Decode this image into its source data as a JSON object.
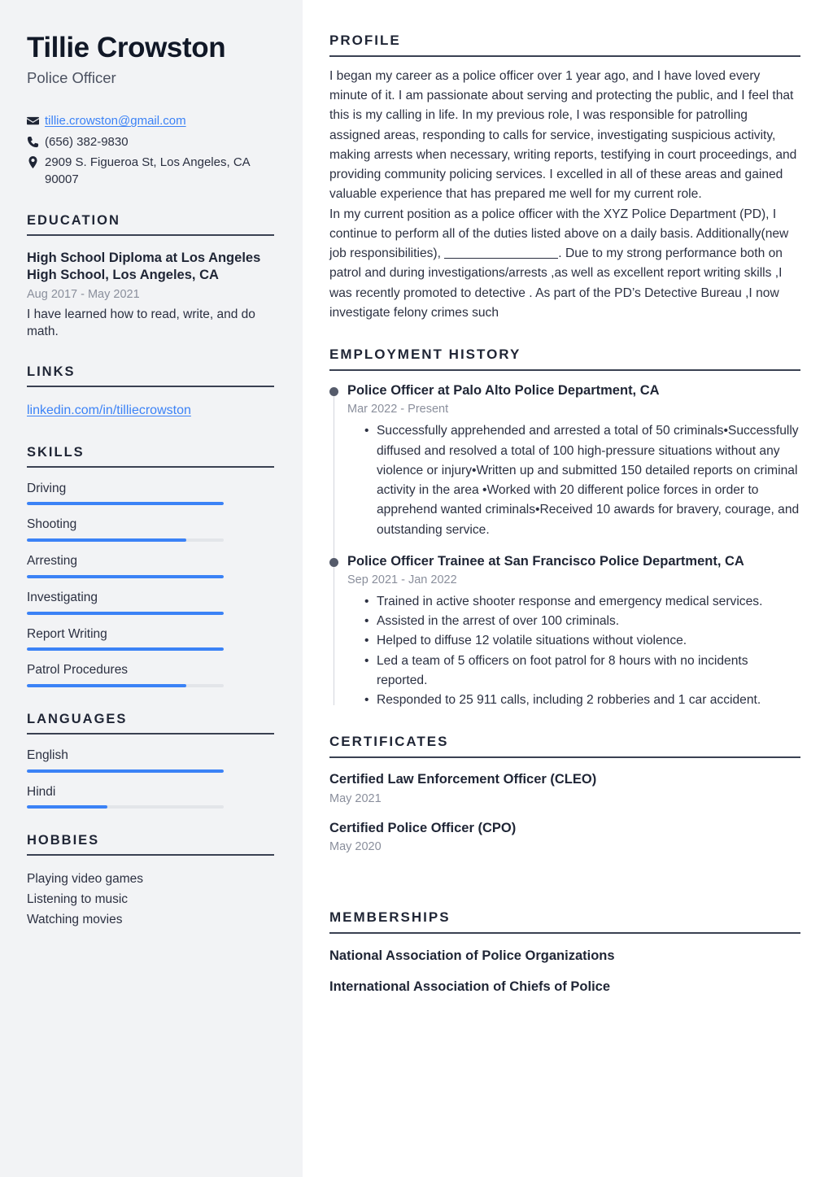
{
  "header": {
    "name": "Tillie Crowston",
    "job_title": "Police Officer"
  },
  "contact": {
    "email": "tillie.crowston@gmail.com",
    "email_icon": "envelope-icon",
    "phone": "(656) 382-9830",
    "phone_icon": "phone-icon",
    "address": "2909 S. Figueroa St, Los Angeles, CA 90007",
    "address_icon": "location-pin-icon"
  },
  "education": {
    "heading": "EDUCATION",
    "degree": "High School Diploma at Los Angeles High School, Los Angeles, CA",
    "date": "Aug 2017 - May 2021",
    "description": "I have learned how to read, write, and do math."
  },
  "links": {
    "heading": "LINKS",
    "items": [
      {
        "label": "linkedin.com/in/tilliecrowston"
      }
    ]
  },
  "skills": {
    "heading": "SKILLS",
    "items": [
      {
        "label": "Driving",
        "level": 100
      },
      {
        "label": "Shooting",
        "level": 81
      },
      {
        "label": "Arresting",
        "level": 100
      },
      {
        "label": "Investigating",
        "level": 100
      },
      {
        "label": "Report Writing",
        "level": 100
      },
      {
        "label": "Patrol Procedures",
        "level": 81
      }
    ]
  },
  "languages": {
    "heading": "LANGUAGES",
    "items": [
      {
        "label": "English",
        "level": 100
      },
      {
        "label": "Hindi",
        "level": 41
      }
    ]
  },
  "hobbies": {
    "heading": "HOBBIES",
    "items": [
      {
        "label": "Playing video games"
      },
      {
        "label": "Listening to music"
      },
      {
        "label": "Watching movies"
      }
    ]
  },
  "profile": {
    "heading": "PROFILE",
    "paragraph_1": "I began my career as a police officer over 1 year ago, and I have loved every minute of it. I am passionate about serving and protecting the public, and I feel that this is my calling in life. In my previous role, I was responsible for patrolling assigned areas, responding to calls for service, investigating suspicious activity, making arrests when necessary, writing reports, testifying in court proceedings, and providing community policing services. I excelled in all of these areas and gained valuable experience that has prepared me well for my current role.",
    "paragraph_2_before": "In my current position as a police officer with the XYZ Police Department (PD), I continue to perform all of the duties listed above on a daily basis. Additionally(new job responsibilities), ",
    "paragraph_2_after": ". Due to my strong performance both on patrol and during investigations/arrests ,as well as excellent report writing skills ,I was recently promoted to detective . As part of the PD’s Detective Bureau ,I now investigate felony crimes such"
  },
  "employment": {
    "heading": "EMPLOYMENT HISTORY",
    "jobs": [
      {
        "role": "Police Officer at Palo Alto Police Department, CA",
        "date": "Mar 2022 - Present",
        "bullets": [
          "Successfully apprehended and arrested a total of 50 criminals•Successfully diffused and resolved a total of 100 high-pressure situations without any violence or injury•Written up and submitted 150 detailed reports on criminal activity in the area •Worked with 20 different police forces in order to apprehend wanted criminals•Received 10 awards for bravery, courage, and outstanding service."
        ]
      },
      {
        "role": "Police Officer Trainee at San Francisco Police Department, CA",
        "date": "Sep 2021 - Jan 2022",
        "bullets": [
          "Trained in active shooter response and emergency medical services.",
          "Assisted in the arrest of over 100 criminals.",
          "Helped to diffuse 12 volatile situations without violence.",
          "Led a team of 5 officers on foot patrol for 8 hours with no incidents reported.",
          "Responded to 25 911 calls, including 2 robberies and 1 car accident."
        ]
      }
    ]
  },
  "certificates": {
    "heading": "CERTIFICATES",
    "items": [
      {
        "name": "Certified Law Enforcement Officer (CLEO)",
        "date": "May 2021"
      },
      {
        "name": "Certified Police Officer (CPO)",
        "date": "May 2020"
      }
    ]
  },
  "memberships": {
    "heading": "MEMBERSHIPS",
    "items": [
      {
        "name": "National Association of Police Organizations"
      },
      {
        "name": "International Association of Chiefs of Police"
      }
    ]
  },
  "colors": {
    "accent_blue": "#3b82f6",
    "sidebar_bg": "#f2f3f5",
    "heading_dark": "#1f2535",
    "muted_gray": "#8a8f9c"
  }
}
